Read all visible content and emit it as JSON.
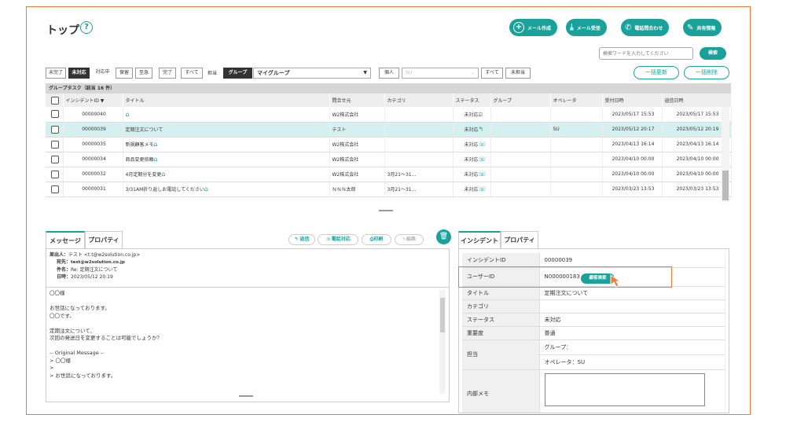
{
  "page_title": "トップ",
  "help_label": "?",
  "toolbar": {
    "mail_create": "メール作成",
    "mail_receive": "メール受信",
    "phone_inquiry": "電話問合わせ",
    "share_info": "共有情報"
  },
  "search": {
    "placeholder": "検索ワードを入力してください",
    "button": "検索"
  },
  "filters": {
    "status_buttons": [
      "未完了",
      "未対応",
      "対応中",
      "保留",
      "至急",
      "完了",
      "すべて"
    ],
    "assignee_label": "担当",
    "group_label": "グループ",
    "group_value": "マイグループ",
    "individual_label": "個人",
    "individual_value": "SU",
    "all_label": "すべて",
    "unassigned_label": "未担当",
    "bulk_update": "一括更新",
    "bulk_delete": "一括削除"
  },
  "grid": {
    "heading": "グループタスク（該当 16 件）",
    "columns": [
      "インシデントID ▼",
      "タイトル",
      "問合せ元",
      "カテゴリ",
      "ステータス",
      "グループ",
      "オペレータ",
      "受付日時",
      "返信日時"
    ],
    "rows": [
      {
        "id": "00000040",
        "title": "",
        "source": "W2株式会社",
        "category": "",
        "status": "未対応",
        "group": "",
        "operator": "",
        "received": "2023/05/17 15:53",
        "replied": "2023/05/17 15:53"
      },
      {
        "id": "00000039",
        "title": "定期注文について",
        "source": "テスト",
        "category": "",
        "status": "未対応",
        "group": "",
        "operator": "SU",
        "received": "2023/05/12 20:17",
        "replied": "2023/05/12 20:19"
      },
      {
        "id": "00000035",
        "title": "新規顧客メモ",
        "source": "W2株式会社",
        "category": "",
        "status": "未対応",
        "group": "",
        "operator": "",
        "received": "2023/04/13 16:14",
        "replied": "2023/04/13 16:14"
      },
      {
        "id": "00000034",
        "title": "商品変更依頼",
        "source": "W2株式会社",
        "category": "",
        "status": "未対応",
        "group": "",
        "operator": "",
        "received": "2023/04/10 00:00",
        "replied": "2023/04/10 00:00"
      },
      {
        "id": "00000032",
        "title": "4月定期分を変更",
        "source": "W2株式会社",
        "category": "3月21～31...",
        "status": "未対応",
        "group": "",
        "operator": "",
        "received": "2023/04/10 00:00",
        "replied": "2023/04/10 00:00"
      },
      {
        "id": "00000031",
        "title": "3/31AM折り返しお電話してください",
        "source": "ＮＮＮ太郎",
        "category": "3月21～31...",
        "status": "未対応",
        "group": "",
        "operator": "",
        "received": "2023/03/23 13:53",
        "replied": "2023/03/23 13:53"
      }
    ]
  },
  "message_panel": {
    "tabs": [
      "メッセージ",
      "プロパティ"
    ],
    "actions": [
      "返信",
      "電話対応",
      "印刷",
      "編集"
    ],
    "from_label": "差出人：",
    "from_value": "テスト <t.t@w2solution.co.jp>",
    "to_label": "宛先：",
    "to_value": "test@w2solution.co.jp",
    "subject_label": "件名：",
    "subject_value": "Re: 定期注文について",
    "date_label": "日時：",
    "date_value": "2023/05/12 20:19",
    "body": [
      "〇〇様",
      "",
      "お世話になっております。",
      "〇〇です。",
      "",
      "定期注文について、",
      "次回の発送日を変更することは可能でしょうか？",
      "",
      "-- Original Message --",
      "> 〇〇様",
      ">",
      "> お世話になっております。"
    ]
  },
  "incident_panel": {
    "tabs": [
      "インシデント",
      "プロパティ"
    ],
    "rows": [
      {
        "label": "インシデントID",
        "value": "00000039"
      },
      {
        "label": "ユーザーID",
        "value": "N000000183"
      },
      {
        "label": "タイトル",
        "value": "定期注文について"
      },
      {
        "label": "カテゴリ",
        "value": ""
      },
      {
        "label": "ステータス",
        "value": "未対応"
      },
      {
        "label": "重要度",
        "value": "普通"
      }
    ],
    "assignee_label": "担当",
    "group_line": "グループ：",
    "operator_line": "オペレータ：SU",
    "memo_label": "内部メモ",
    "customer_search": "顧客検索"
  },
  "colors": {
    "accent": "#1aa19a",
    "highlight": "#f07a3a"
  }
}
